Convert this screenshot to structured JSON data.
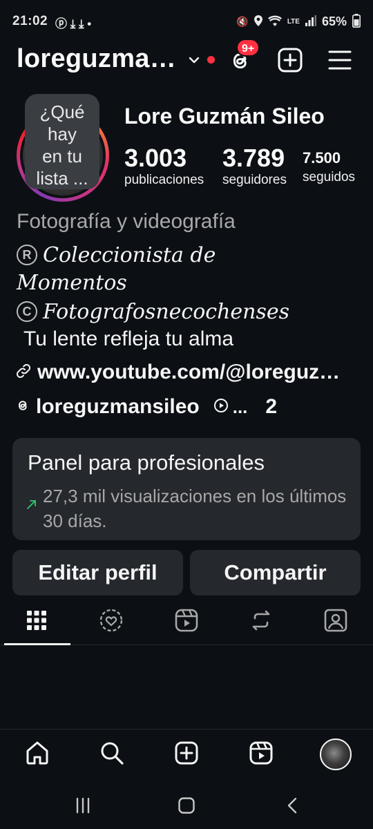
{
  "status_bar": {
    "time": "21:02",
    "left_icons": "ⓟ ⤓ ⤓ •",
    "battery": "65%",
    "network_label": "LTE"
  },
  "header": {
    "username": "loreguzmansileo",
    "notification_badge": "9+"
  },
  "profile": {
    "full_name": "Lore Guzmán Sileo",
    "note_lines": [
      "¿Qué",
      "hay",
      "en tu",
      "lista ..."
    ],
    "stats": [
      {
        "value": "3.003",
        "label": "publicaciones"
      },
      {
        "value": "3.789",
        "label": "seguidores"
      },
      {
        "value": "7.500",
        "label": "seguidos"
      }
    ]
  },
  "bio": {
    "category": "Fotografía y videografía",
    "line1_symbol": "R",
    "line1": "Coleccionista de",
    "line2": "Momentos",
    "line3_symbol": "C",
    "line3": "Fotografosnecochenses",
    "line4": "Tu lente refleja tu alma",
    "link": "www.youtube.com/@loreguzmansileo",
    "threads_handle": "loreguzmansileo",
    "more_dots": "...",
    "more_count": "2"
  },
  "dashboard": {
    "title": "Panel para profesionales",
    "subtitle": "27,3 mil visualizaciones en los últimos 30 días."
  },
  "actions": {
    "edit": "Editar perfil",
    "share": "Compartir"
  },
  "tabs": [
    "grid-icon",
    "highlights-icon",
    "reels-icon",
    "reposts-icon",
    "tagged-icon"
  ],
  "colors": {
    "background": "#0c1014",
    "card": "#25282d",
    "badge": "#ff3040",
    "secondary_text": "#a8a8a8",
    "trend_arrow": "#2ecc71"
  }
}
